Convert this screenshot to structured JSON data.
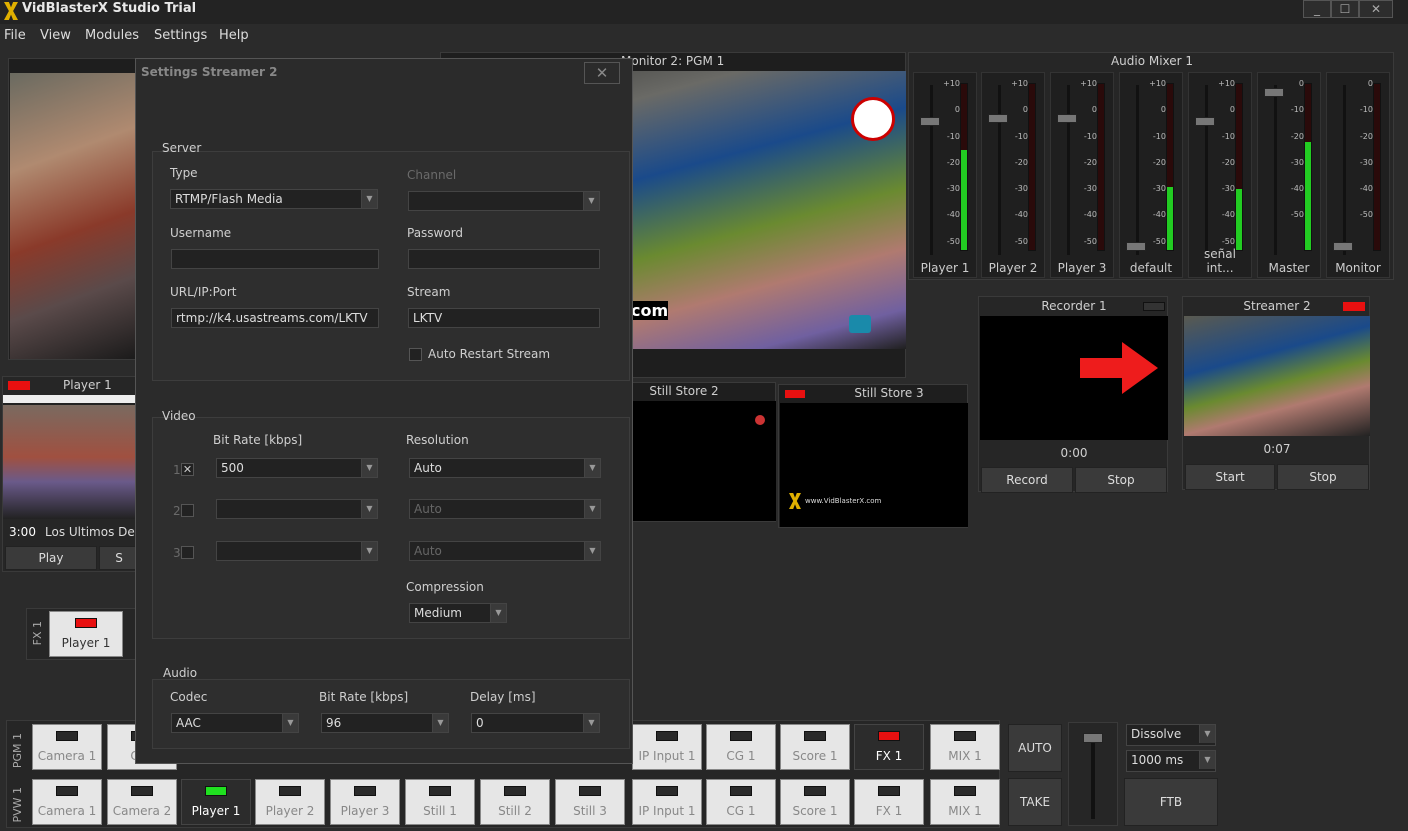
{
  "app": {
    "title": "VidBlasterX Studio Trial",
    "min": "_",
    "max": "☐",
    "close": "✕"
  },
  "menu": [
    "File",
    "View",
    "Modules",
    "Settings",
    "Help"
  ],
  "monitor2": {
    "title": "Monitor 2: PGM 1",
    "lower": "com"
  },
  "audio_mixer": {
    "title": "Audio Mixer 1",
    "strips": [
      {
        "name": "Player 1",
        "level": 0.6,
        "fader": 0.8,
        "scale": [
          "+10",
          "0",
          "-10",
          "-20",
          "-30",
          "-40",
          "-50"
        ]
      },
      {
        "name": "Player 2",
        "level": 0.0,
        "fader": 0.82,
        "scale": [
          "+10",
          "0",
          "-10",
          "-20",
          "-30",
          "-40",
          "-50"
        ]
      },
      {
        "name": "Player 3",
        "level": 0.0,
        "fader": 0.82,
        "scale": [
          "+10",
          "0",
          "-10",
          "-20",
          "-30",
          "-40",
          "-50"
        ]
      },
      {
        "name": "default",
        "level": 0.38,
        "fader": 0.02,
        "scale": [
          "+10",
          "0",
          "-10",
          "-20",
          "-30",
          "-40",
          "-50"
        ]
      },
      {
        "name": "señal int...",
        "level": 0.37,
        "fader": 0.8,
        "scale": [
          "+10",
          "0",
          "-10",
          "-20",
          "-30",
          "-40",
          "-50"
        ]
      },
      {
        "name": "Master",
        "level": 0.65,
        "fader": 0.98,
        "scale": [
          "0",
          "-10",
          "-20",
          "-30",
          "-40",
          "-50"
        ]
      },
      {
        "name": "Monitor",
        "level": 0.0,
        "fader": 0.02,
        "scale": [
          "0",
          "-10",
          "-20",
          "-30",
          "-40",
          "-50"
        ]
      }
    ]
  },
  "recorder": {
    "title": "Recorder 1",
    "time": "0:00",
    "record": "Record",
    "stop": "Stop"
  },
  "streamer": {
    "title": "Streamer 2",
    "time": "0:07",
    "start": "Start",
    "stop": "Stop"
  },
  "still2": {
    "title": "Still Store 2"
  },
  "still3": {
    "title": "Still Store 3",
    "logo_text": "www.VidBlasterX.com"
  },
  "player1": {
    "title": "Player 1",
    "time": "3:00",
    "clip": "Los Ultimos Desc",
    "play": "Play",
    "stop": "S"
  },
  "fx": {
    "label": "FX 1",
    "tile": "Player 1"
  },
  "dialog": {
    "title": "Settings Streamer 2",
    "close": "✕",
    "server": {
      "group": "Server",
      "type_label": "Type",
      "type_value": "RTMP/Flash Media",
      "channel_label": "Channel",
      "username_label": "Username",
      "password_label": "Password",
      "url_label": "URL/IP:Port",
      "url_value": "rtmp://k4.usastreams.com/LKTV",
      "stream_label": "Stream",
      "stream_value": "LKTV",
      "auto_restart": "Auto Restart Stream"
    },
    "video": {
      "group": "Video",
      "bitrate_label": "Bit Rate [kbps]",
      "resolution_label": "Resolution",
      "rows": [
        {
          "num": "1",
          "check": "✕",
          "bitrate": "500",
          "resolution": "Auto"
        },
        {
          "num": "2",
          "check": "",
          "bitrate": "",
          "resolution": "Auto"
        },
        {
          "num": "3",
          "check": "",
          "bitrate": "",
          "resolution": "Auto"
        }
      ],
      "compression_label": "Compression",
      "compression_value": "Medium"
    },
    "audio": {
      "group": "Audio",
      "codec_label": "Codec",
      "codec_value": "AAC",
      "bitrate_label": "Bit Rate [kbps]",
      "bitrate_value": "96",
      "delay_label": "Delay [ms]",
      "delay_value": "0"
    }
  },
  "switcher": {
    "pgm_label": "PGM 1",
    "pvw_label": "PVW 1",
    "pgm": [
      {
        "label": "Camera 1",
        "state": "off"
      },
      {
        "label": "Can",
        "state": "off"
      },
      {
        "label": "IP Input 1",
        "state": "off"
      },
      {
        "label": "CG 1",
        "state": "off"
      },
      {
        "label": "Score 1",
        "state": "off"
      },
      {
        "label": "FX 1",
        "state": "red"
      },
      {
        "label": "MIX 1",
        "state": "off"
      }
    ],
    "pvw": [
      {
        "label": "Camera 1",
        "state": "off"
      },
      {
        "label": "Camera 2",
        "state": "off"
      },
      {
        "label": "Player 1",
        "state": "green"
      },
      {
        "label": "Player 2",
        "state": "off"
      },
      {
        "label": "Player 3",
        "state": "off"
      },
      {
        "label": "Still 1",
        "state": "off"
      },
      {
        "label": "Still 2",
        "state": "off"
      },
      {
        "label": "Still 3",
        "state": "off"
      },
      {
        "label": "IP Input 1",
        "state": "off"
      },
      {
        "label": "CG 1",
        "state": "off"
      },
      {
        "label": "Score 1",
        "state": "off"
      },
      {
        "label": "FX 1",
        "state": "off"
      },
      {
        "label": "MIX 1",
        "state": "off"
      }
    ],
    "auto": "AUTO",
    "take": "TAKE",
    "transition": "Dissolve",
    "duration": "1000 ms",
    "ftb": "FTB"
  }
}
